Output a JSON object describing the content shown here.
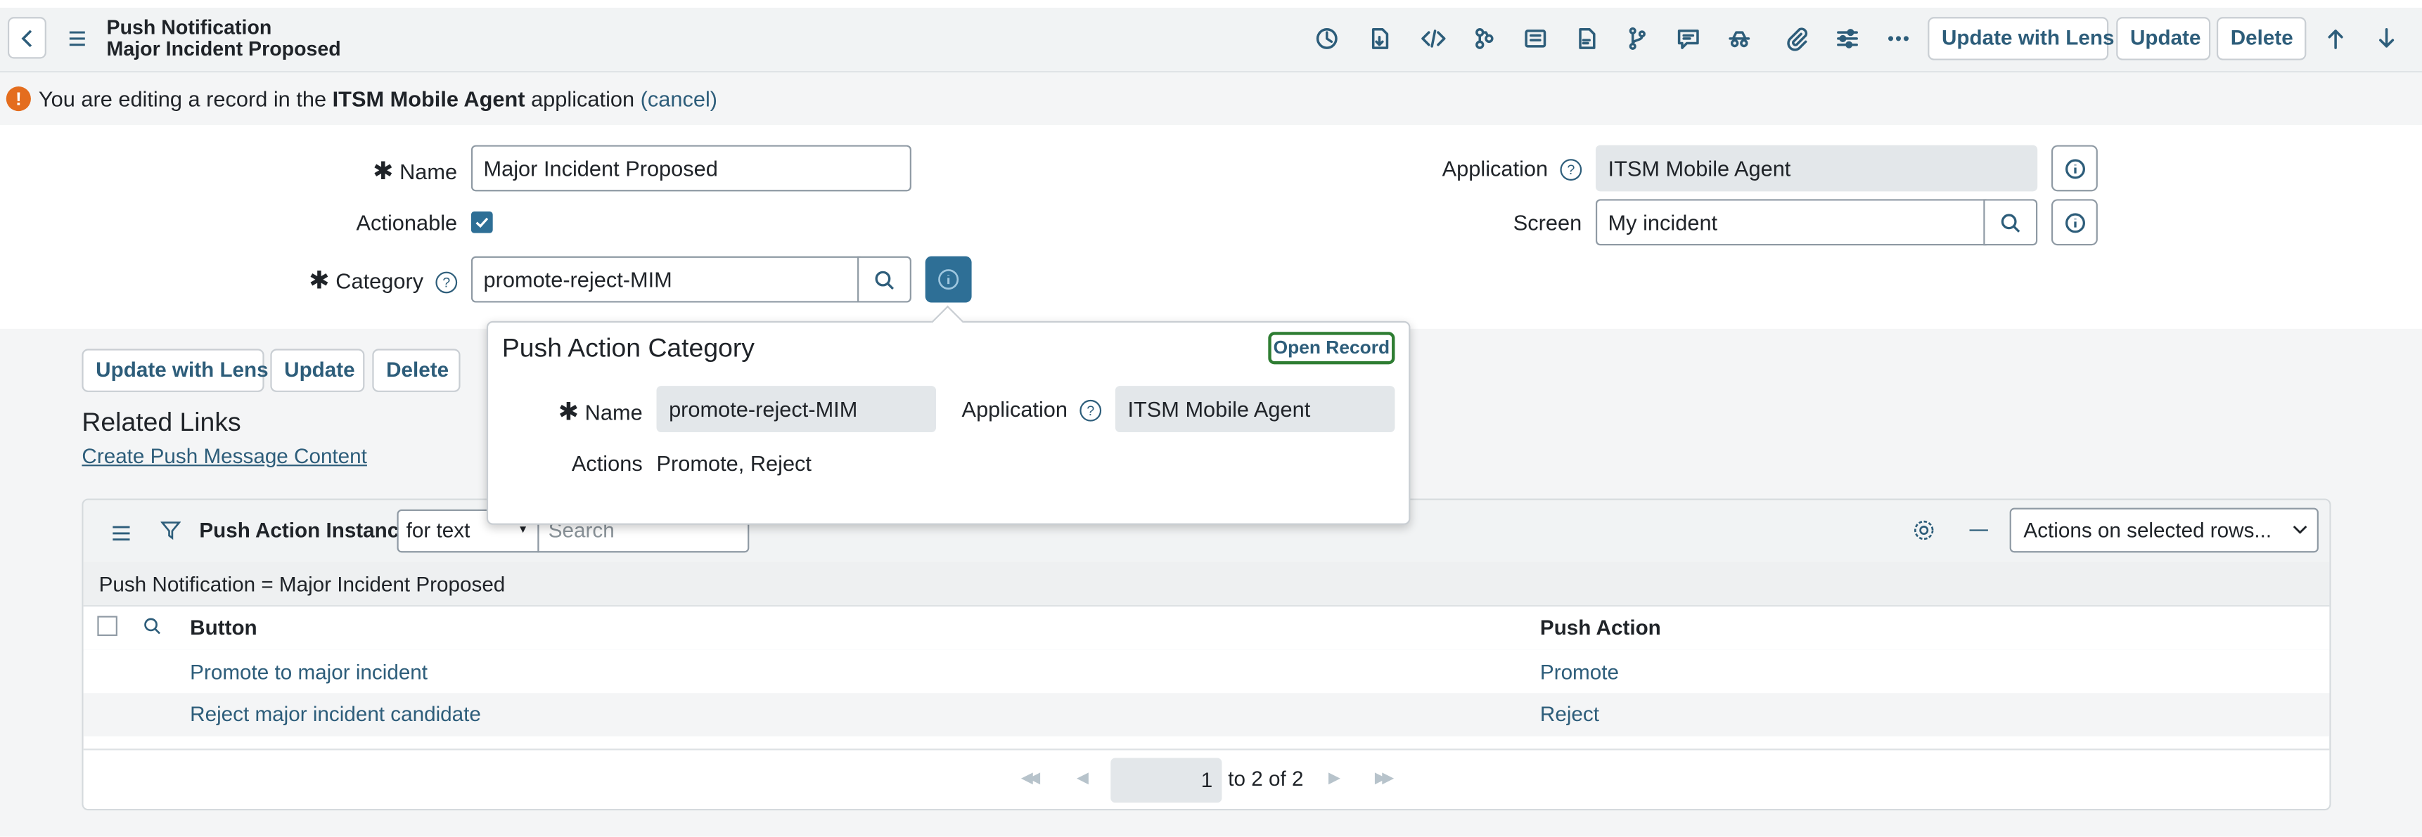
{
  "header": {
    "title_line1": "Push Notification",
    "title_line2": "Major Incident Proposed",
    "buttons": {
      "update_with_lens": "Update with Lens",
      "update": "Update",
      "delete": "Delete"
    },
    "icons": [
      "history-icon",
      "attachment-download-icon",
      "code-icon",
      "flow-icon",
      "form-icon",
      "pdf-icon",
      "git-branch-icon",
      "comment-icon",
      "spy-icon",
      "paperclip-icon",
      "sliders-icon",
      "more-icon",
      "arrow-up-icon",
      "arrow-down-icon"
    ]
  },
  "banner": {
    "pre": "You are editing a record in the",
    "app": "ITSM Mobile Agent",
    "post": "application",
    "cancel": "(cancel)",
    "color": "#e46d1e"
  },
  "form": {
    "name_label": "Name",
    "name_value": "Major Incident Proposed",
    "actionable_label": "Actionable",
    "actionable_checked": true,
    "category_label": "Category",
    "category_value": "promote-reject-MIM",
    "application_label": "Application",
    "application_value": "ITSM Mobile Agent",
    "screen_label": "Screen",
    "screen_value": "My incident"
  },
  "popup": {
    "title": "Push Action Category",
    "open_record": "Open Record",
    "name_label": "Name",
    "name_value": "promote-reject-MIM",
    "application_label": "Application",
    "application_value": "ITSM Mobile Agent",
    "actions_label": "Actions",
    "actions_value": "Promote, Reject"
  },
  "bottom_buttons": {
    "update_with_lens": "Update with Lens",
    "update": "Update",
    "delete": "Delete"
  },
  "related_links": {
    "title": "Related Links",
    "link": "Create Push Message Content"
  },
  "list": {
    "title": "Push Action Instances",
    "search_field": "for text",
    "search_placeholder": "Search",
    "actions_select": "Actions on selected rows...",
    "breadcrumb": "Push Notification = Major Incident Proposed",
    "columns": [
      "Button",
      "Push Action"
    ],
    "rows": [
      {
        "button": "Promote to major incident",
        "push_action": "Promote"
      },
      {
        "button": "Reject major incident candidate",
        "push_action": "Reject"
      }
    ],
    "pagination": {
      "current": "1",
      "to": "to",
      "last": "2",
      "of": "of",
      "total": "2"
    }
  },
  "colors": {
    "accent": "#2d5d7a",
    "header_bg": "#f1f3f4",
    "popup_border_green": "#2e7d32",
    "info_active_bg": "#2e6f96"
  }
}
